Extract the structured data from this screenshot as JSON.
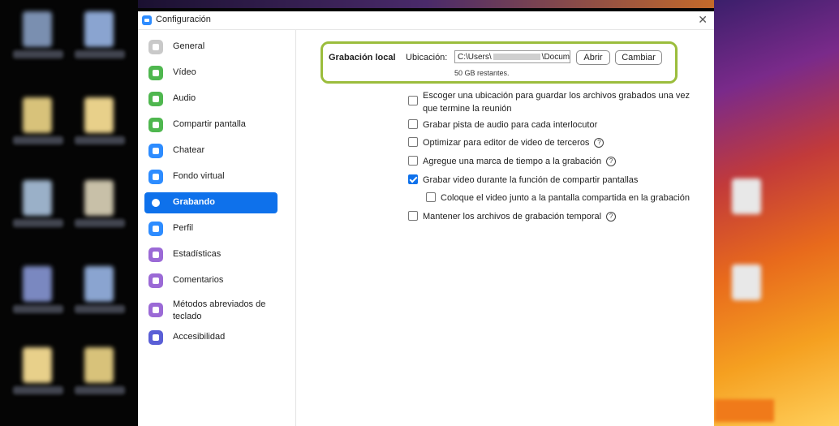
{
  "window": {
    "title": "Configuración"
  },
  "sidebar": {
    "items": [
      {
        "label": "General",
        "icon": "gear-icon",
        "color": "#c9c9c9"
      },
      {
        "label": "Vídeo",
        "icon": "video-icon",
        "color": "#4fb74f"
      },
      {
        "label": "Audio",
        "icon": "headphones-icon",
        "color": "#4fb74f"
      },
      {
        "label": "Compartir pantalla",
        "icon": "share-screen-icon",
        "color": "#4fb74f"
      },
      {
        "label": "Chatear",
        "icon": "chat-icon",
        "color": "#2d8cff"
      },
      {
        "label": "Fondo virtual",
        "icon": "virtual-background-icon",
        "color": "#2d8cff"
      },
      {
        "label": "Grabando",
        "icon": "record-icon",
        "color": "#0e71eb"
      },
      {
        "label": "Perfil",
        "icon": "profile-icon",
        "color": "#2d8cff"
      },
      {
        "label": "Estadísticas",
        "icon": "statistics-icon",
        "color": "#9b6ad6"
      },
      {
        "label": "Comentarios",
        "icon": "feedback-icon",
        "color": "#9b6ad6"
      },
      {
        "label": "Métodos abreviados de teclado",
        "icon": "keyboard-icon",
        "color": "#9b6ad6"
      },
      {
        "label": "Accesibilidad",
        "icon": "accessibility-icon",
        "color": "#5a5fd6"
      }
    ],
    "active_index": 6
  },
  "recording": {
    "section_label": "Grabación local",
    "location_label": "Ubicación:",
    "path_start": "C:\\Users\\",
    "path_end": "\\Documer",
    "open_button": "Abrir",
    "change_button": "Cambiar",
    "free_space": "50 GB restantes.",
    "options": [
      {
        "text": "Escoger una ubicación para guardar los archivos grabados una vez que termine la reunión",
        "checked": false,
        "help": false
      },
      {
        "text": "Grabar pista de audio para cada interlocutor",
        "checked": false,
        "help": false
      },
      {
        "text": "Optimizar para editor de video de terceros",
        "checked": false,
        "help": true
      },
      {
        "text": "Agregue una marca de tiempo a la grabación",
        "checked": false,
        "help": true
      },
      {
        "text": "Grabar video durante la función de compartir pantallas",
        "checked": true,
        "help": false
      },
      {
        "text": "Coloque el video junto a la pantalla compartida en la grabación",
        "checked": false,
        "help": false
      },
      {
        "text": "Mantener los archivos de grabación temporal",
        "checked": false,
        "help": true
      }
    ]
  },
  "colors": {
    "accent": "#0e71eb",
    "highlight": "#9bbd3c"
  }
}
